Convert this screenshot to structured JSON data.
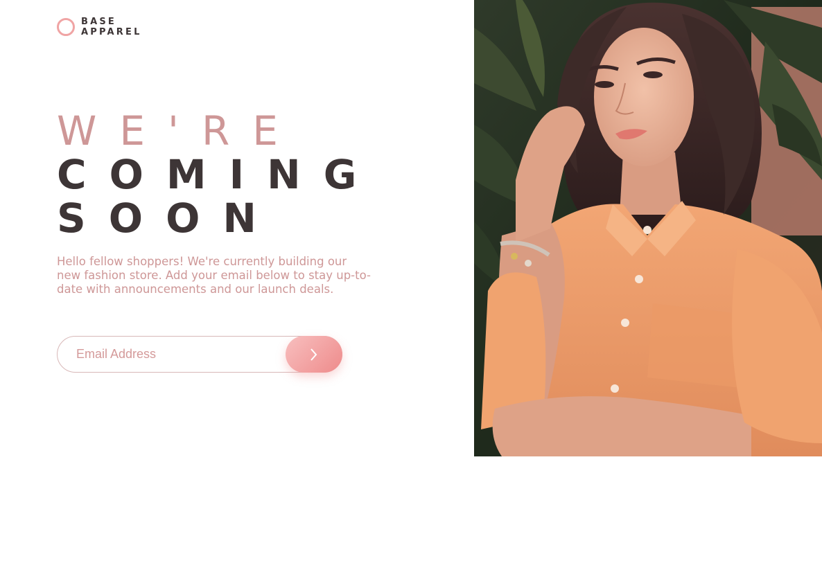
{
  "brand": {
    "logo_line1": "BASE",
    "logo_line2": "APPAREL"
  },
  "hero": {
    "heading_line1": "WE'RE",
    "heading_line2": "COMING",
    "heading_line3": "SOON",
    "intro": "Hello fellow shoppers! We're currently building our new fashion store. Add your email below to stay up-to-date with announcements and our launch deals."
  },
  "form": {
    "email_placeholder": "Email Address",
    "email_value": ""
  },
  "colors": {
    "accent": "#ce9797",
    "dark": "#3d3536",
    "button_start": "#f8bfbf",
    "button_end": "#ee8b8b"
  },
  "icons": {
    "logo": "ring-logo-icon",
    "submit": "chevron-right-icon"
  }
}
